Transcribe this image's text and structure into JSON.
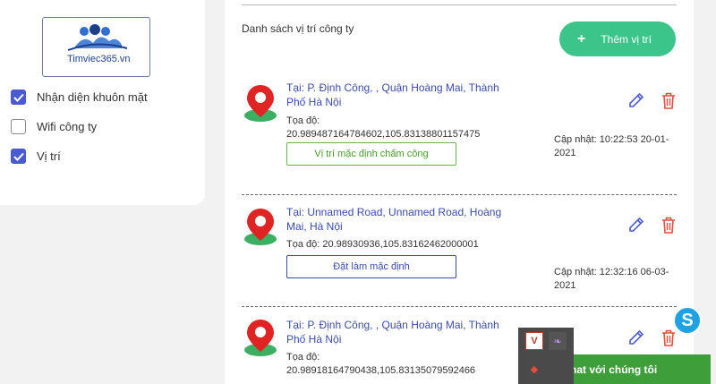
{
  "sidebar": {
    "logo_text": "Timviec365.vn",
    "options": [
      {
        "label": "Nhận diện khuôn mặt",
        "checked": true
      },
      {
        "label": "Wifi công ty",
        "checked": false
      },
      {
        "label": "Vị trí",
        "checked": true
      }
    ]
  },
  "main": {
    "list_title": "Danh sách vị trí công ty",
    "add_button": {
      "icon": "plus-icon",
      "label": "Thêm vị trí"
    },
    "locations": [
      {
        "address": "Tại: P. Định Công, , Quận Hoàng Mai, Thành Phố Hà Nội",
        "coords": "Tọa độ: 20.989487164784602,105.83138801157475",
        "action_label": "Vị trí mặc định chấm công",
        "updated": "Cập nhật: 10:22:53 20-01-2021"
      },
      {
        "address": "Tại: Unnamed Road, Unnamed Road, Hoàng Mai, Hà Nội",
        "coords": "Tọa độ: 20.98930936,105.83162462000001",
        "action_label": "Đặt làm mặc định",
        "updated": "Cập nhật: 12:32:16 06-03-2021"
      },
      {
        "address": "Tại: P. Định Công, , Quận Hoàng Mai, Thành Phố Hà Nội",
        "coords": "Tọa độ: 20.98918164790438,105.83135079592466",
        "action_label": "",
        "updated": ""
      }
    ]
  },
  "chat": {
    "label": "hat với chúng tôi"
  },
  "colors": {
    "accent_green": "#3bc58a",
    "link_blue": "#3a4ba8",
    "delete_red": "#e74c3c",
    "checkbox_blue": "#4a5bd2"
  }
}
